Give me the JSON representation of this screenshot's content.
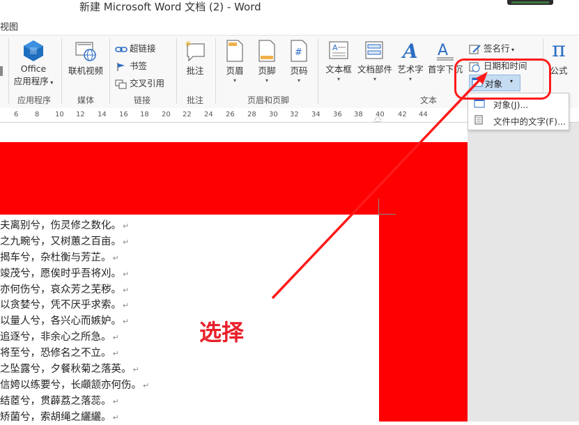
{
  "window": {
    "title": "新建 Microsoft Word 文档 (2) - Word"
  },
  "tabs": {
    "view_label": "视图"
  },
  "ribbon": {
    "office_app": {
      "label": "Office",
      "label2": "应用程序",
      "group": "应用程序"
    },
    "online_video": {
      "label": "联机视频",
      "group": "媒体"
    },
    "links": {
      "hyperlink": "超链接",
      "bookmark": "书签",
      "crossref": "交叉引用",
      "group": "链接"
    },
    "comment": {
      "label": "批注",
      "group": "批注"
    },
    "header_footer": {
      "header": "页眉",
      "footer": "页脚",
      "page_number": "页码",
      "group": "页眉和页脚"
    },
    "text": {
      "textbox": "文本框",
      "quick_parts": "文档部件",
      "wordart": "艺术字",
      "dropcap": "首字下沉",
      "signature": "签名行",
      "datetime": "日期和时间",
      "object": "对象",
      "group": "文本"
    },
    "equation": {
      "label": "公式"
    }
  },
  "dropdown": {
    "items": [
      {
        "label": "对象(J)...",
        "icon": "object-icon"
      },
      {
        "label": "文件中的文字(F)...",
        "icon": "file-text-icon"
      }
    ]
  },
  "ruler": {
    "ticks": [
      "6",
      "8",
      "10",
      "12",
      "14",
      "16",
      "18",
      "20",
      "22",
      "24",
      "26",
      "28",
      "30",
      "32",
      "34",
      "36",
      "38",
      "40",
      "42",
      "44"
    ]
  },
  "document": {
    "lines": [
      "夫离别兮，伤灵修之数化。",
      "之九畹兮，又树蕙之百亩。",
      "揭车兮，杂杜衡与芳芷。",
      "竣茂兮，愿俟时乎吾将刈。",
      "亦何伤兮，哀众芳之芜秽。",
      "以贪婪兮，凭不厌乎求索。",
      "以量人兮，各兴心而嫉妒。",
      "追逐兮，非余心之所急。",
      "将至兮，恐修名之不立。",
      "之坠露兮，夕餐秋菊之落英。",
      "信姱以练要兮，长顑颔亦何伤。",
      "结茝兮，贯薜荔之落蕊。",
      "矫菌兮，索胡绳之纚纚。"
    ],
    "paragraph_mark": "↵"
  },
  "annotation": {
    "label": "选择",
    "color": "#e8202a"
  },
  "colors": {
    "highlight_red": "#ff0000",
    "selected_blue": "#c5dcf3",
    "accent_blue": "#2b6cc4"
  }
}
